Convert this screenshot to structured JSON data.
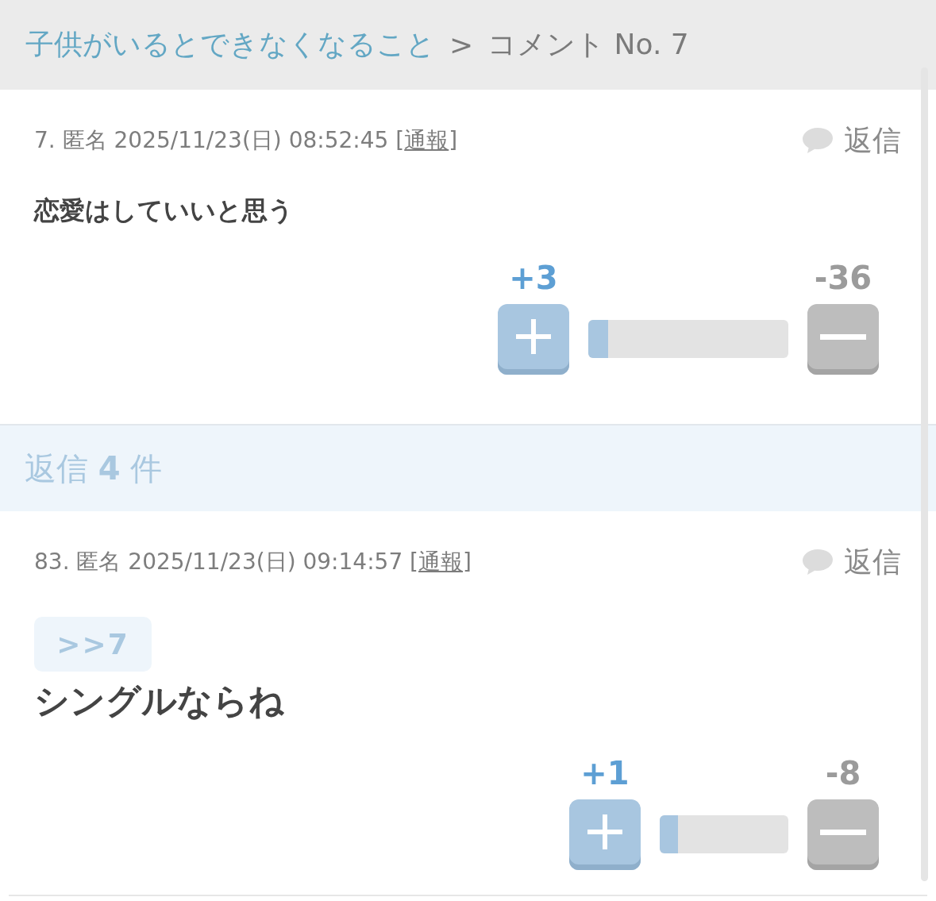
{
  "breadcrumb": {
    "link": "子供がいるとできなくなること",
    "separator": ">",
    "current": "コメント No. 7"
  },
  "comment": {
    "info": "7. 匿名 2025/11/23(日) 08:52:45",
    "report": {
      "open": "[",
      "link": "通報",
      "close": "]"
    },
    "reply_button": "返信",
    "body": "恋愛はしていいと思う",
    "votes": {
      "plus": "+3",
      "minus": "-36",
      "level": 0.1
    }
  },
  "reply_count": "返信 **4** 件",
  "replies": [
    {
      "info": "83. 匿名 2025/11/23(日) 09:14:57",
      "report": {
        "open": "[",
        "link": "通報",
        "close": "]"
      },
      "reply_button": "返信",
      "anchor": ">>7",
      "body": "シングルならね",
      "votes": {
        "plus": "+1",
        "minus": "-8",
        "level": 0.14
      }
    }
  ]
}
